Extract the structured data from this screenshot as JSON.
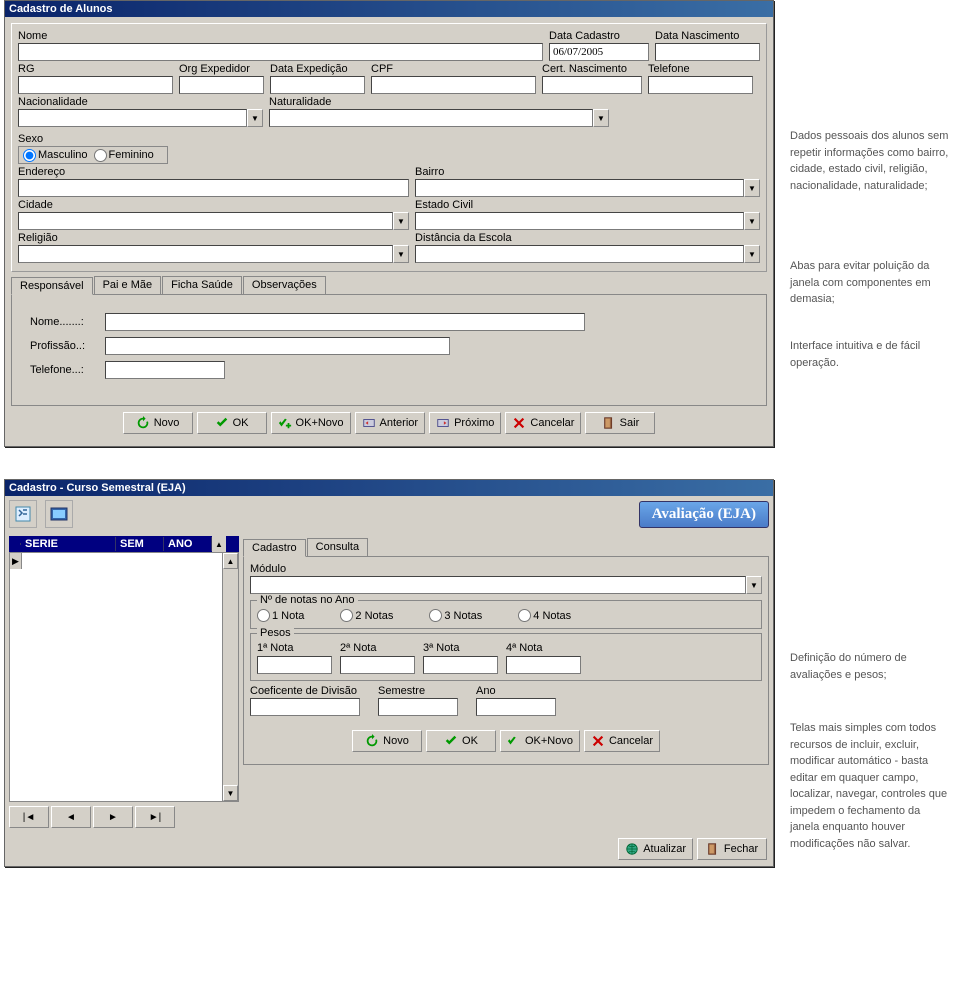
{
  "window1": {
    "title": "Cadastro de Alunos",
    "fields": {
      "nome": "Nome",
      "data_cadastro": "Data Cadastro",
      "data_cadastro_val": "06/07/2005",
      "data_nascimento": "Data Nascimento",
      "rg": "RG",
      "org_expedidor": "Org Expedidor",
      "data_expedicao": "Data Expedição",
      "cpf": "CPF",
      "cert_nascimento": "Cert. Nascimento",
      "telefone": "Telefone",
      "nacionalidade": "Nacionalidade",
      "naturalidade": "Naturalidade",
      "sexo": "Sexo",
      "masculino": "Masculino",
      "feminino": "Feminino",
      "endereco": "Endereço",
      "bairro": "Bairro",
      "cidade": "Cidade",
      "estado_civil": "Estado Civil",
      "religiao": "Religião",
      "distancia_escola": "Distância da Escola"
    },
    "tabs": {
      "responsavel": "Responsável",
      "pai_mae": "Pai e Mãe",
      "ficha_saude": "Ficha Saúde",
      "observacoes": "Observações"
    },
    "responsavel": {
      "nome": "Nome.......:",
      "profissao": "Profissão..:",
      "telefone": "Telefone...:"
    },
    "buttons": {
      "novo": "Novo",
      "ok": "OK",
      "ok_novo": "OK+Novo",
      "anterior": "Anterior",
      "proximo": "Próximo",
      "cancelar": "Cancelar",
      "sair": "Sair"
    }
  },
  "notes": {
    "n1": "Dados pessoais dos alunos sem repetir informações como bairro, cidade, estado civil, religião, nacionalidade, naturalidade;",
    "n2": "Abas para evitar poluição da janela com componentes em demasia;",
    "n3": "Interface intuitiva e de fácil operação.",
    "n4": "Definição do número de avaliações e pesos;",
    "n5": "Telas mais simples com todos recursos de incluir, excluir, modificar automático - basta editar em quaquer campo, localizar, navegar, controles que impedem o fechamento da janela enquanto houver modificações não salvar."
  },
  "window2": {
    "title": "Cadastro - Curso Semestral (EJA)",
    "banner": "Avaliação (EJA)",
    "grid_headers": {
      "serie": "SERIE",
      "sem": "SEM",
      "ano": "ANO"
    },
    "tabs": {
      "cadastro": "Cadastro",
      "consulta": "Consulta"
    },
    "modulo_label": "Módulo",
    "notas_group": "Nº de notas no Ano",
    "notas": {
      "n1": "1 Nota",
      "n2": "2 Notas",
      "n3": "3 Notas",
      "n4": "4 Notas"
    },
    "pesos_group": "Pesos",
    "pesos": {
      "p1": "1ª Nota",
      "p2": "2ª Nota",
      "p3": "3ª Nota",
      "p4": "4ª Nota"
    },
    "coef": "Coeficente de Divisão",
    "semestre": "Semestre",
    "ano": "Ano",
    "buttons": {
      "novo": "Novo",
      "ok": "OK",
      "ok_novo": "OK+Novo",
      "cancelar": "Cancelar",
      "atualizar": "Atualizar",
      "fechar": "Fechar"
    }
  }
}
